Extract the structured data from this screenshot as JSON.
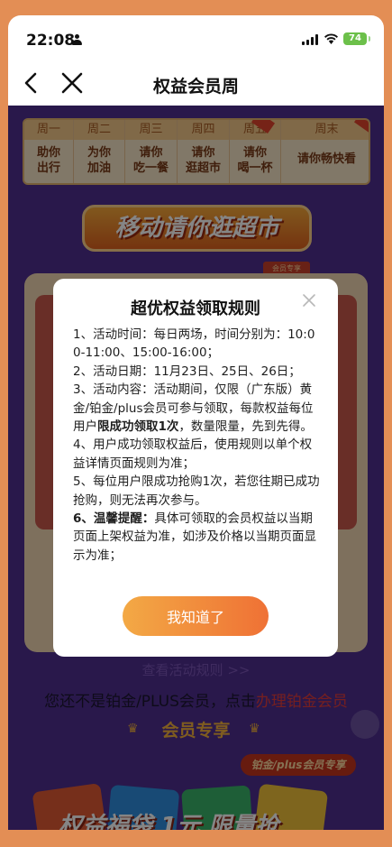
{
  "status_bar": {
    "time": "22:08",
    "battery": "74"
  },
  "nav": {
    "title": "权益会员周"
  },
  "week": [
    {
      "day": "周一",
      "lines": [
        "助你",
        "出行"
      ]
    },
    {
      "day": "周二",
      "lines": [
        "为你",
        "加油"
      ]
    },
    {
      "day": "周三",
      "lines": [
        "请你",
        "吃一餐"
      ]
    },
    {
      "day": "周四",
      "lines": [
        "请你",
        "逛超市"
      ]
    },
    {
      "day": "周五",
      "lines": [
        "请你",
        "喝一杯"
      ]
    },
    {
      "day": "周末",
      "lines": [
        "请你畅快看"
      ]
    }
  ],
  "banner": {
    "title": "移动请你逛超市",
    "member_chip": "会员专享"
  },
  "footer": {
    "rules_link": "查看活动规则 >>",
    "notice_prefix": "您还不是铂金/PLUS会员，点击",
    "notice_link": "办理铂金会员",
    "section_title": "会员专享",
    "exclusive_tag": "铂金/plus会员专享",
    "promo_text": "权益福袋 1元 限量抢"
  },
  "modal": {
    "title": "超优权益领取规则",
    "rules": [
      {
        "text": "1、活动时间：每日两场，时间分别为：10:00-11:00、15:00-16:00；"
      },
      {
        "text": "2、活动日期：11月23日、25日、26日；"
      },
      {
        "pre": "3、活动内容：活动期间，仅限（广东版）黄金/铂金/plus会员可参与领取，每款权益每位用户",
        "bold": "限成功领取1次",
        "post": "，数量限量，先到先得。"
      },
      {
        "text": "4、用户成功领取权益后，使用规则以单个权益详情页面规则为准；"
      },
      {
        "text": "5、每位用户限成功抢购1次，若您往期已成功抢购，则无法再次参与。"
      },
      {
        "bold": "6、温馨提醒：",
        "post": "具体可领取的会员权益以当期页面上架权益为准，如涉及价格以当期页面显示为准；"
      }
    ],
    "ok_button": "我知道了"
  },
  "colors": {
    "page_orange": "#e38e55",
    "content_purple": "#4f2f90",
    "button_gradient_start": "#f3a945",
    "button_gradient_end": "#ef7135",
    "link_red": "#e23d3d"
  }
}
